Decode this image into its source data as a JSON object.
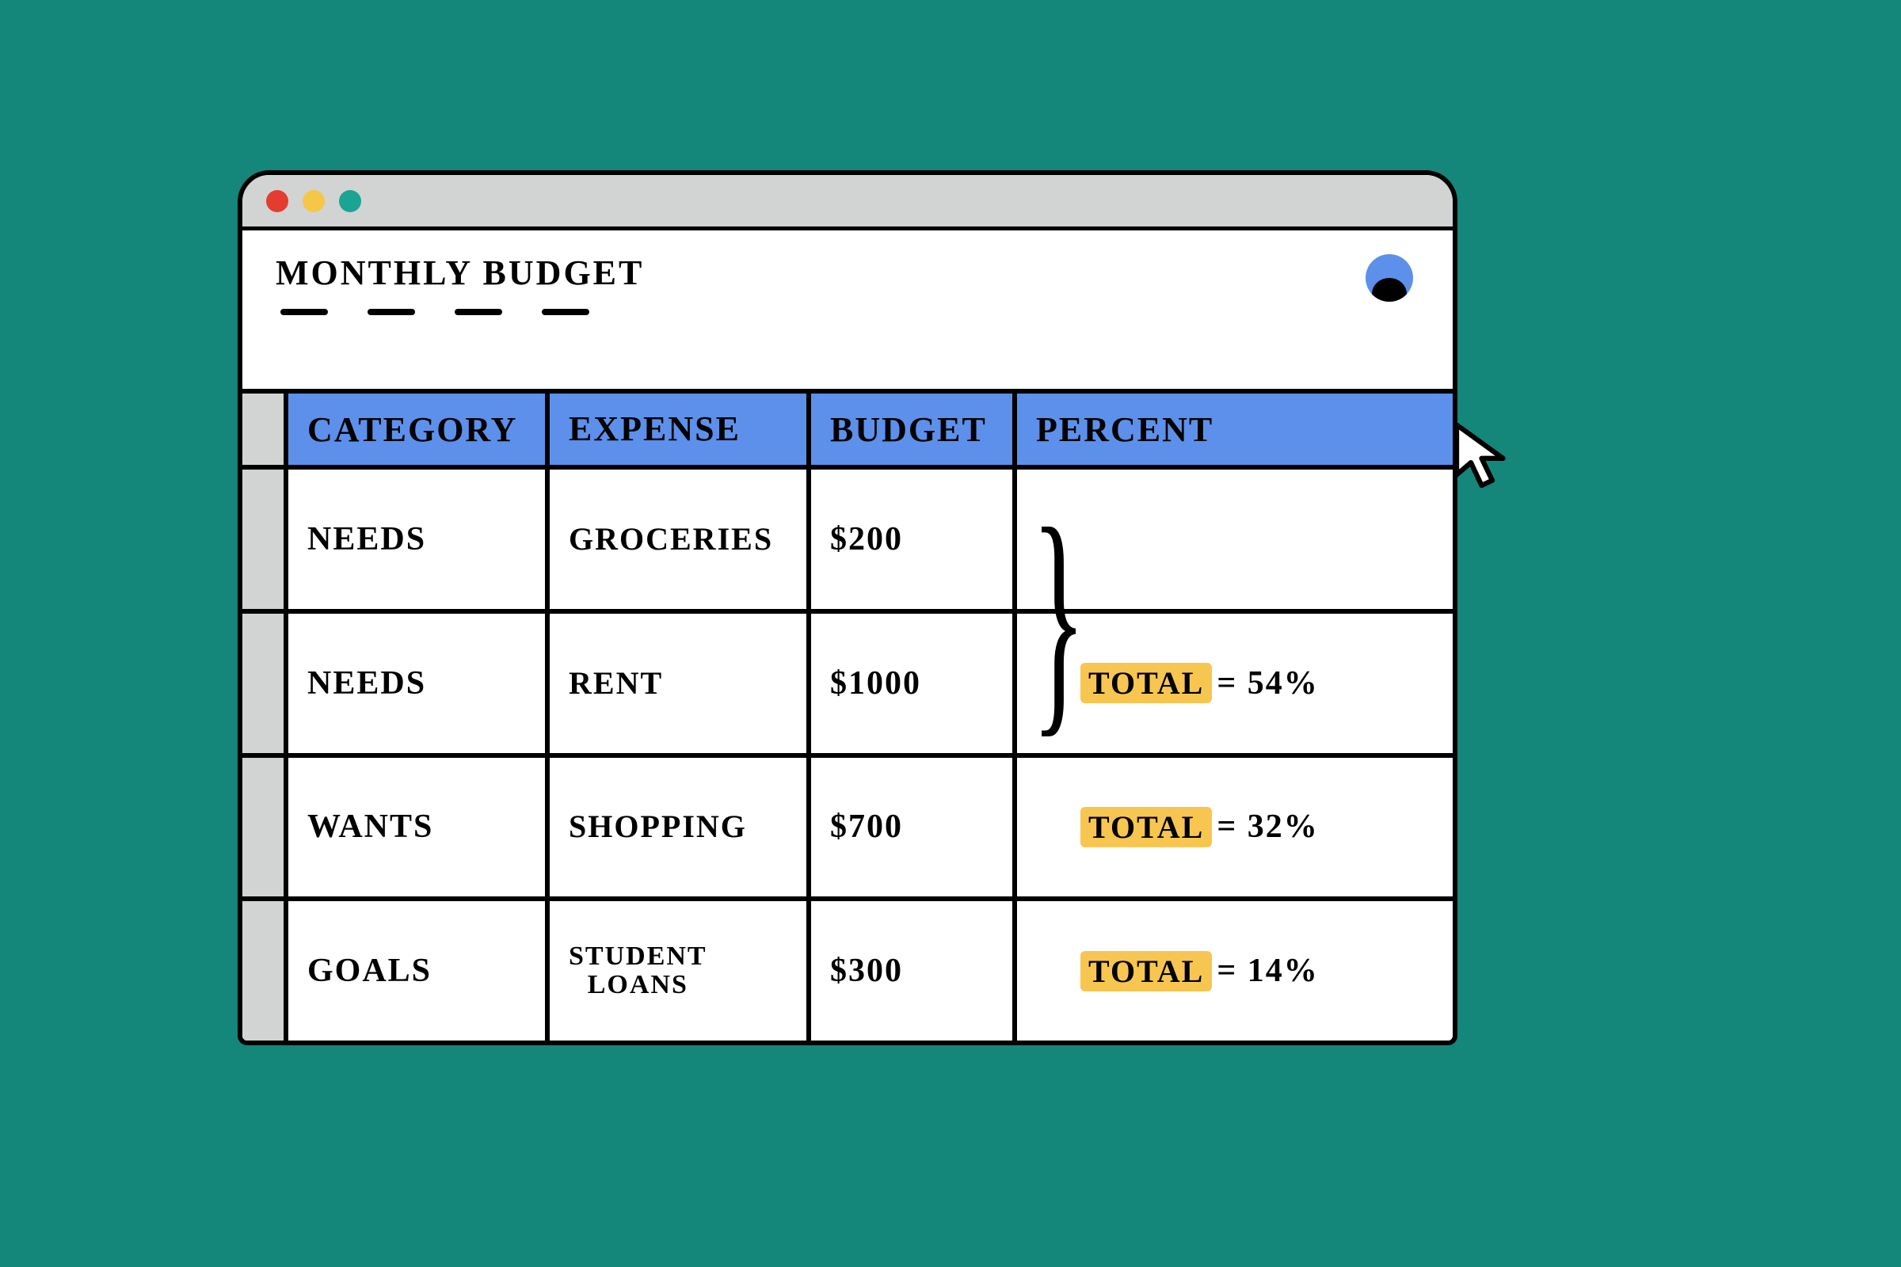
{
  "chart_data": {
    "type": "table",
    "title": "MONTHLY BUDGET",
    "columns": [
      "CATEGORY",
      "EXPENSE",
      "BUDGET",
      "PERCENT"
    ],
    "rows": [
      {
        "category": "NEEDS",
        "expense": "GROCERIES",
        "budget": 200,
        "group": "NEEDS"
      },
      {
        "category": "NEEDS",
        "expense": "RENT",
        "budget": 1000,
        "group": "NEEDS"
      },
      {
        "category": "WANTS",
        "expense": "SHOPPING",
        "budget": 700,
        "group": "WANTS"
      },
      {
        "category": "GOALS",
        "expense": "STUDENT LOANS",
        "budget": 300,
        "group": "GOALS"
      }
    ],
    "group_totals": [
      {
        "group": "NEEDS",
        "percent": 54
      },
      {
        "group": "WANTS",
        "percent": 32
      },
      {
        "group": "GOALS",
        "percent": 14
      }
    ]
  },
  "header": {
    "title": "MONTHLY BUDGET"
  },
  "columns": {
    "c1": "CATEGORY",
    "c2": "EXPENSE",
    "c3": "BUDGET",
    "c4": "PERCENT"
  },
  "rows": [
    {
      "category": "NEEDS",
      "expense": "GROCERIES",
      "budget": "$200",
      "percent_label": "",
      "percent_value": ""
    },
    {
      "category": "NEEDS",
      "expense": "RENT",
      "budget": "$1000",
      "percent_label": "TOTAL",
      "percent_value": "= 54%"
    },
    {
      "category": "WANTS",
      "expense": "SHOPPING",
      "budget": "$700",
      "percent_label": "TOTAL",
      "percent_value": "= 32%"
    },
    {
      "category": "GOALS",
      "expense": "STUDENT\nLOANS",
      "budget": "$300",
      "percent_label": "TOTAL",
      "percent_value": "= 14%"
    }
  ],
  "colors": {
    "background": "#14867a",
    "header_row": "#5d90ea",
    "highlight": "#f7c651"
  }
}
